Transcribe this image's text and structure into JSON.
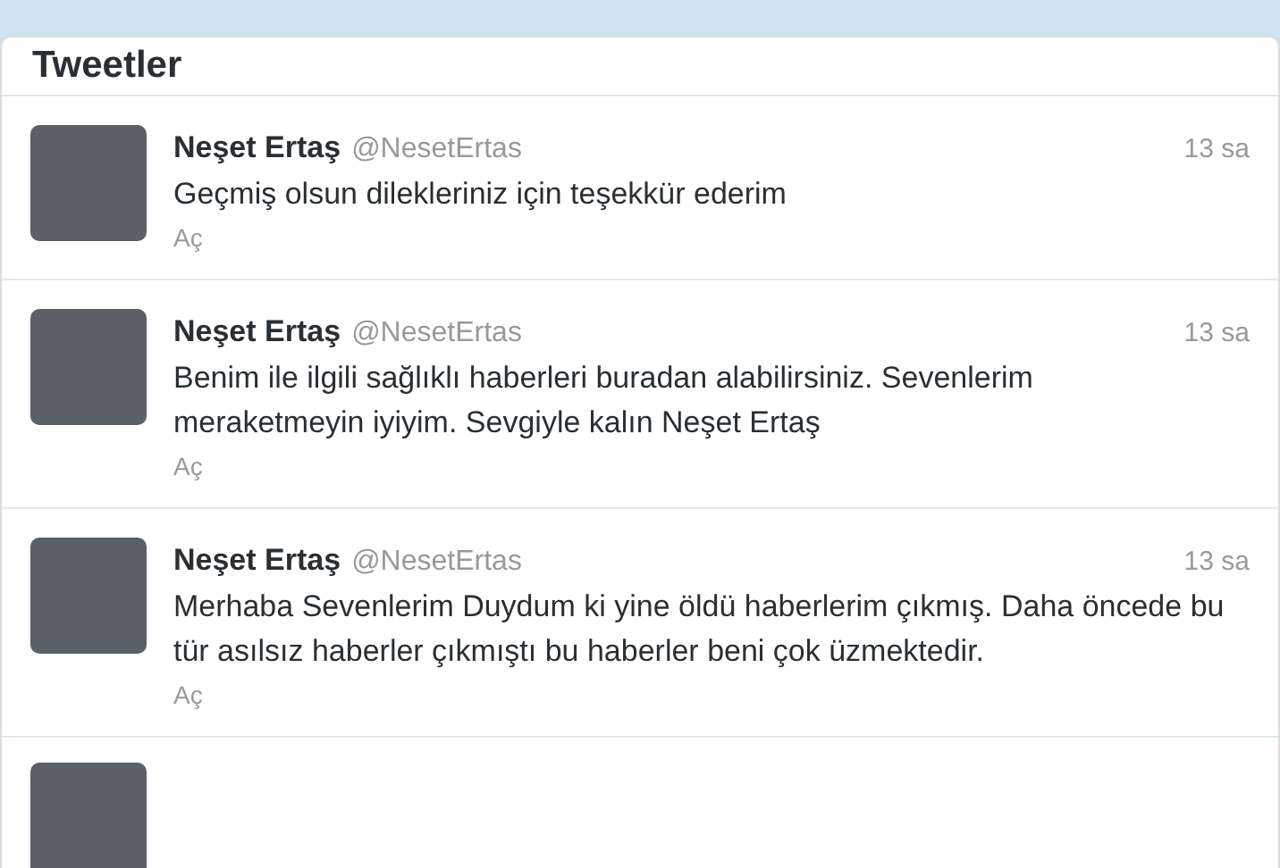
{
  "header": {
    "title": "Tweetler"
  },
  "tweets": [
    {
      "name": "Neşet Ertaş",
      "handle": "@NesetErtas",
      "time": "13 sa",
      "text": "Geçmiş olsun dilekleriniz için teşekkür ederim",
      "action": "Aç"
    },
    {
      "name": "Neşet Ertaş",
      "handle": "@NesetErtas",
      "time": "13 sa",
      "text": "Benim ile ilgili sağlıklı haberleri buradan alabilirsiniz. Sevenlerim meraketmeyin iyiyim. Sevgiyle kalın Neşet Ertaş",
      "action": "Aç"
    },
    {
      "name": "Neşet Ertaş",
      "handle": "@NesetErtas",
      "time": "13 sa",
      "text": "Merhaba Sevenlerim Duydum ki yine öldü haberlerim çıkmış. Daha öncede bu tür asılsız haberler çıkmıştı bu haberler beni çok üzmektedir.",
      "action": "Aç"
    }
  ]
}
